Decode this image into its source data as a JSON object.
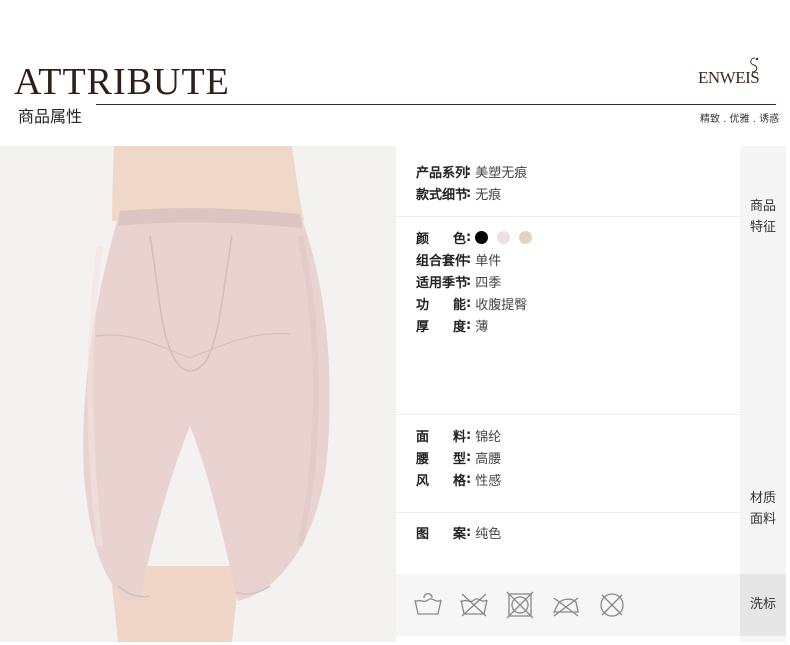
{
  "header": {
    "title_en": "ATTRIBUTE",
    "title_zh": "商品属性",
    "brand": "ENWEIS",
    "slogan": "精致 . 优雅 . 诱惑"
  },
  "product_features": [
    {
      "label": "产品系列",
      "value": "美塑无痕"
    },
    {
      "label": "款式细节",
      "value": "无痕"
    }
  ],
  "colors": {
    "label_a": "颜",
    "label_b": "色",
    "swatches": [
      "#000000",
      "#efe1e3",
      "#e6d3bc"
    ]
  },
  "basic_attrs": [
    {
      "label": "组合套件",
      "value": "单件"
    },
    {
      "label": "适用季节",
      "value": "四季"
    },
    {
      "label_a": "功",
      "label_b": "能",
      "value": "收腹提臀"
    },
    {
      "label_a": "厚",
      "label_b": "度",
      "value": "薄"
    }
  ],
  "material_attrs": [
    {
      "label_a": "面",
      "label_b": "料",
      "value": "锦纶"
    },
    {
      "label_a": "腰",
      "label_b": "型",
      "value": "高腰"
    },
    {
      "label_a": "风",
      "label_b": "格",
      "value": "性感"
    }
  ],
  "pattern_attr": {
    "label_a": "图",
    "label_b": "案",
    "value": "纯色"
  },
  "side_labels": {
    "features_line1": "商品",
    "features_line2": "特征",
    "material_line1": "材质",
    "material_line2": "面料",
    "wash": "洗标"
  },
  "wash_icons": [
    "hand-wash-icon",
    "no-wash-icon",
    "no-tumble-dry-icon",
    "no-iron-icon",
    "no-dry-clean-icon"
  ],
  "colors_theme": {
    "garment": "#e9d5d3",
    "skin": "#f1d9ca",
    "accent": "#3a2a22"
  }
}
